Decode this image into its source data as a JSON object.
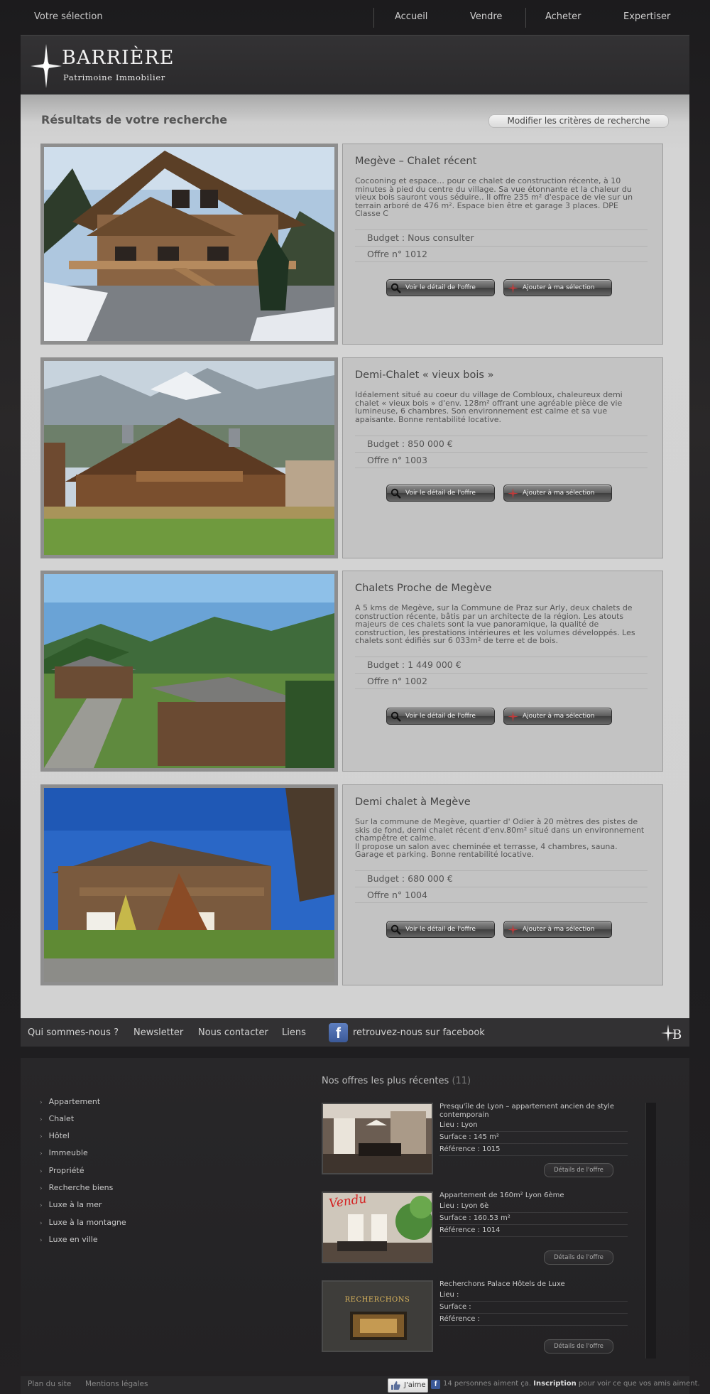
{
  "topnav": {
    "selection_label": "Votre sélection",
    "links": [
      "Accueil",
      "Vendre",
      "Acheter",
      "Expertiser"
    ]
  },
  "brand": {
    "name": "BARRIÈRE",
    "tagline": "Patrimoine Immobilier"
  },
  "results": {
    "title": "Résultats de votre recherche",
    "modify_label": "Modifier les critères de recherche",
    "detail_label": "Voir le détail de l'offre",
    "add_label": "Ajouter à ma sélection",
    "cards": [
      {
        "title": "Megève – Chalet récent",
        "description": "Cocooning et espace… pour ce chalet de construction récente, à 10\nminutes à pied du centre du village. Sa vue étonnante et la chaleur du\nvieux bois sauront vous séduire.. Il offre 235 m² d'espace de vie sur un\nterrain arboré de 476 m². Espace bien être et garage 3 places. DPE\nClasse C",
        "budget": "Budget : Nous consulter",
        "offer": "Offre n° 1012"
      },
      {
        "title": "Demi-Chalet « vieux bois »",
        "description": "Idéalement situé au coeur du village de Combloux, chaleureux demi\nchalet « vieux bois » d'env. 128m² offrant une agréable pièce de vie\nlumineuse, 6 chambres. Son environnement est calme et sa vue\napaisante. Bonne rentabilité locative.",
        "budget": "Budget : 850 000 €",
        "offer": "Offre n° 1003"
      },
      {
        "title": "Chalets Proche de Megève",
        "description": "A 5 kms de Megève, sur la Commune de Praz sur Arly, deux chalets de\nconstruction récente, bâtis par un architecte de la région. Les atouts\nmajeurs de ces chalets sont la vue panoramique, la qualité de\nconstruction, les prestations intérieures et les volumes développés. Les\nchalets sont édifiés sur 6 033m² de terre et de bois.",
        "budget": "Budget : 1 449 000 €",
        "offer": "Offre n° 1002"
      },
      {
        "title": "Demi chalet à Megève",
        "description": "Sur la commune de Megève, quartier d' Odier à 20 mètres des pistes de\nskis de fond, demi chalet récent d'env.80m² situé dans un environnement\nchampêtre et calme.\nIl propose un salon avec cheminée et terrasse, 4 chambres, sauna.\nGarage et parking. Bonne rentabilité locative.",
        "budget": "Budget : 680 000 €",
        "offer": "Offre n° 1004"
      }
    ]
  },
  "footer_nav": {
    "links": [
      "Qui sommes-nous ?",
      "Newsletter",
      "Nous contacter",
      "Liens"
    ],
    "facebook_label": "retrouvez-nous sur facebook"
  },
  "categories": [
    "Appartement",
    "Chalet",
    "Hôtel",
    "Immeuble",
    "Propriété",
    "Recherche biens",
    "Luxe à la mer",
    "Luxe à la montagne",
    "Luxe en ville"
  ],
  "recent": {
    "title": "Nos offres les plus récentes",
    "count": "(11)",
    "detail_label": "Détails de l'offre",
    "offers": [
      {
        "title": "Presqu'île de Lyon – appartement ancien de style contemporain",
        "lieu": "Lieu : Lyon",
        "surface": "Surface : 145 m²",
        "reference": "Référence : 1015"
      },
      {
        "title": "Appartement de 160m² Lyon 6ème",
        "badge": "Vendu",
        "lieu": "Lieu : Lyon 6è",
        "surface": "Surface : 160.53 m²",
        "reference": "Référence : 1014"
      },
      {
        "title": "Recherchons Palace Hôtels de Luxe",
        "sign": "RECHERCHONS",
        "lieu": "Lieu :",
        "surface": "Surface :",
        "reference": "Référence :"
      }
    ]
  },
  "bottom_strip": {
    "sitemap": "Plan du site",
    "legal": "Mentions légales",
    "like": "J'aime",
    "likes_count": "14 personnes aiment ça.",
    "signup": "Inscription",
    "signup_suffix": "pour voir ce que vos amis aiment."
  },
  "icons": [
    "star-logo-icon",
    "magnifier-icon",
    "plus-star-icon",
    "facebook-icon",
    "thumbs-up-icon",
    "chevron-right-icon"
  ]
}
